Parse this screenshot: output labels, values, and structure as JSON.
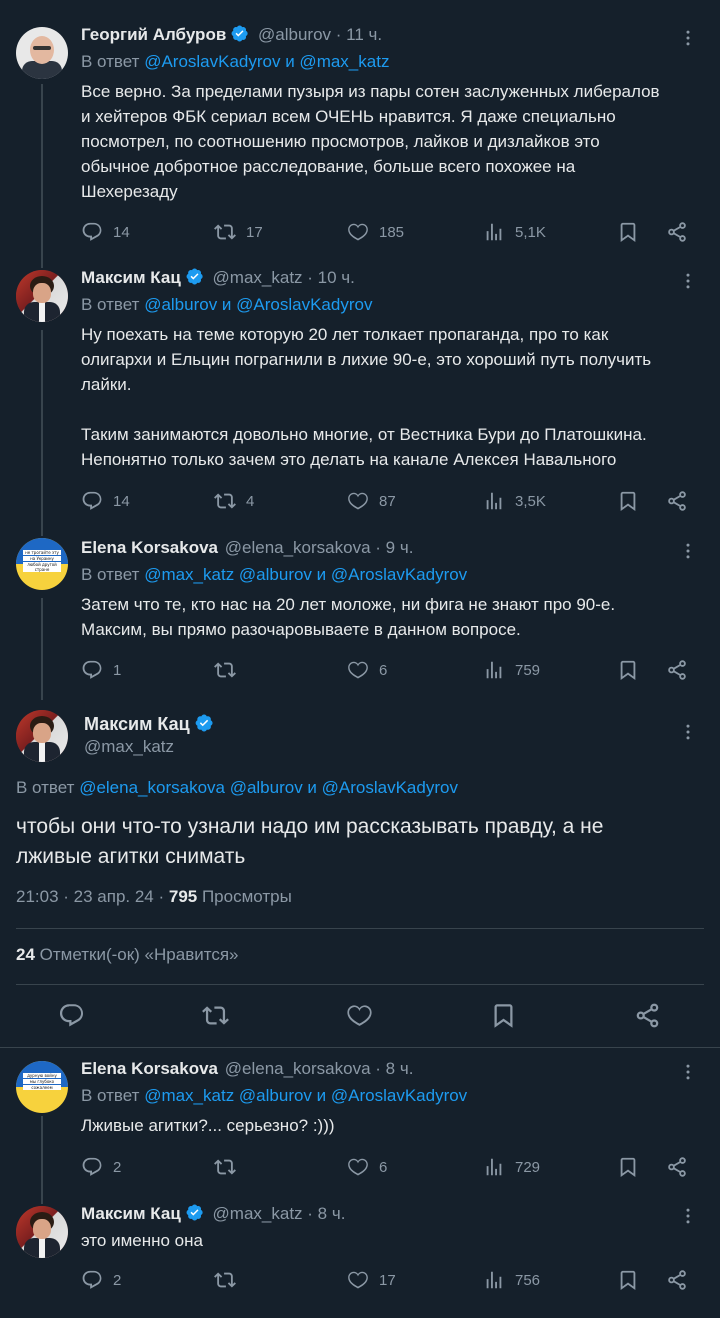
{
  "colors": {
    "background": "#15202b",
    "text": "#e7e9ea",
    "muted": "#8b98a5",
    "link": "#1d9bf0",
    "divider": "#38444d",
    "verified": "#1d9bf0"
  },
  "tweets": [
    {
      "name": "Георгий Албуров",
      "handle": "@alburov",
      "time": "11 ч.",
      "reply_prefix": "В ответ",
      "reply_to": "@AroslavKadyrov и @max_katz",
      "text_lines": [
        "Все верно. За пределами пузыря из пары сотен заслуженных либералов",
        "и хейтеров ФБК сериал всем ОЧЕНЬ нравится. Я даже специально",
        "посмотрел, по соотношению просмотров, лайков и дизлайков это",
        "обычное добротное расследование, больше всего похожее на",
        "Шехерезаду"
      ],
      "replies": "14",
      "retweets": "17",
      "likes": "185",
      "views": "5,1K"
    },
    {
      "name": "Максим Кац",
      "handle": "@max_katz",
      "time": "10 ч.",
      "reply_prefix": "В ответ",
      "reply_to": "@alburov и @AroslavKadyrov",
      "text_lines": [
        "Ну поехать на теме которую 20 лет толкает пропаганда, про то как",
        "олигархи и Ельцин пограгнили в лихие 90-е, это хороший путь получить",
        "лайки.",
        "",
        "Таким занимаются довольно многие, от Вестника Бури до Платошкина.",
        "Непонятно только зачем это делать на канале Алексея Навального"
      ],
      "replies": "14",
      "retweets": "4",
      "likes": "87",
      "views": "3,5K"
    },
    {
      "name": "Elena Korsakova",
      "handle": "@elena_korsakova",
      "time": "9 ч.",
      "reply_prefix": "В ответ",
      "reply_to": "@max_katz @alburov и @AroslavKadyrov",
      "text_lines": [
        "Затем что те, кто нас на 20 лет моложе, ни фига не знают про 90-е.",
        "Максим, вы прямо разочаровываете в данном вопросе."
      ],
      "replies": "1",
      "retweets": "",
      "likes": "6",
      "views": "759"
    }
  ],
  "main_tweet": {
    "name": "Максим Кац",
    "handle": "@max_katz",
    "reply_prefix": "В ответ",
    "reply_to": "@elena_korsakova @alburov и @AroslavKadyrov",
    "text_lines": [
      "чтобы они что-то узнали надо им рассказывать правду, а не",
      "лживые агитки снимать"
    ],
    "time": "21:03 · 23 апр. 24 · ",
    "views": "795",
    "views_label": " Просмотры",
    "likes_count": "24",
    "likes_label": " Отметки(-ок) «Нравится»"
  },
  "replies_below": [
    {
      "name": "Elena Korsakova",
      "handle": "@elena_korsakova",
      "time": "8 ч.",
      "reply_prefix": "В ответ",
      "reply_to": "@max_katz @alburov и @AroslavKadyrov",
      "text_lines": [
        "Лживые агитки?... серьезно? :)))"
      ],
      "replies": "2",
      "retweets": "",
      "likes": "6",
      "views": "729"
    },
    {
      "name": "Максим Кац",
      "handle": "@max_katz",
      "time": "8 ч.",
      "reply_prefix": "",
      "reply_to": "",
      "text_lines": [
        "это именно она"
      ],
      "replies": "2",
      "retweets": "",
      "likes": "17",
      "views": "756"
    }
  ],
  "avatar_badge_text": [
    "не трогайте эту",
    "дурную войну",
    "на Украину",
    "любой другой стране",
    "мы глубоко",
    "сожалеем"
  ]
}
